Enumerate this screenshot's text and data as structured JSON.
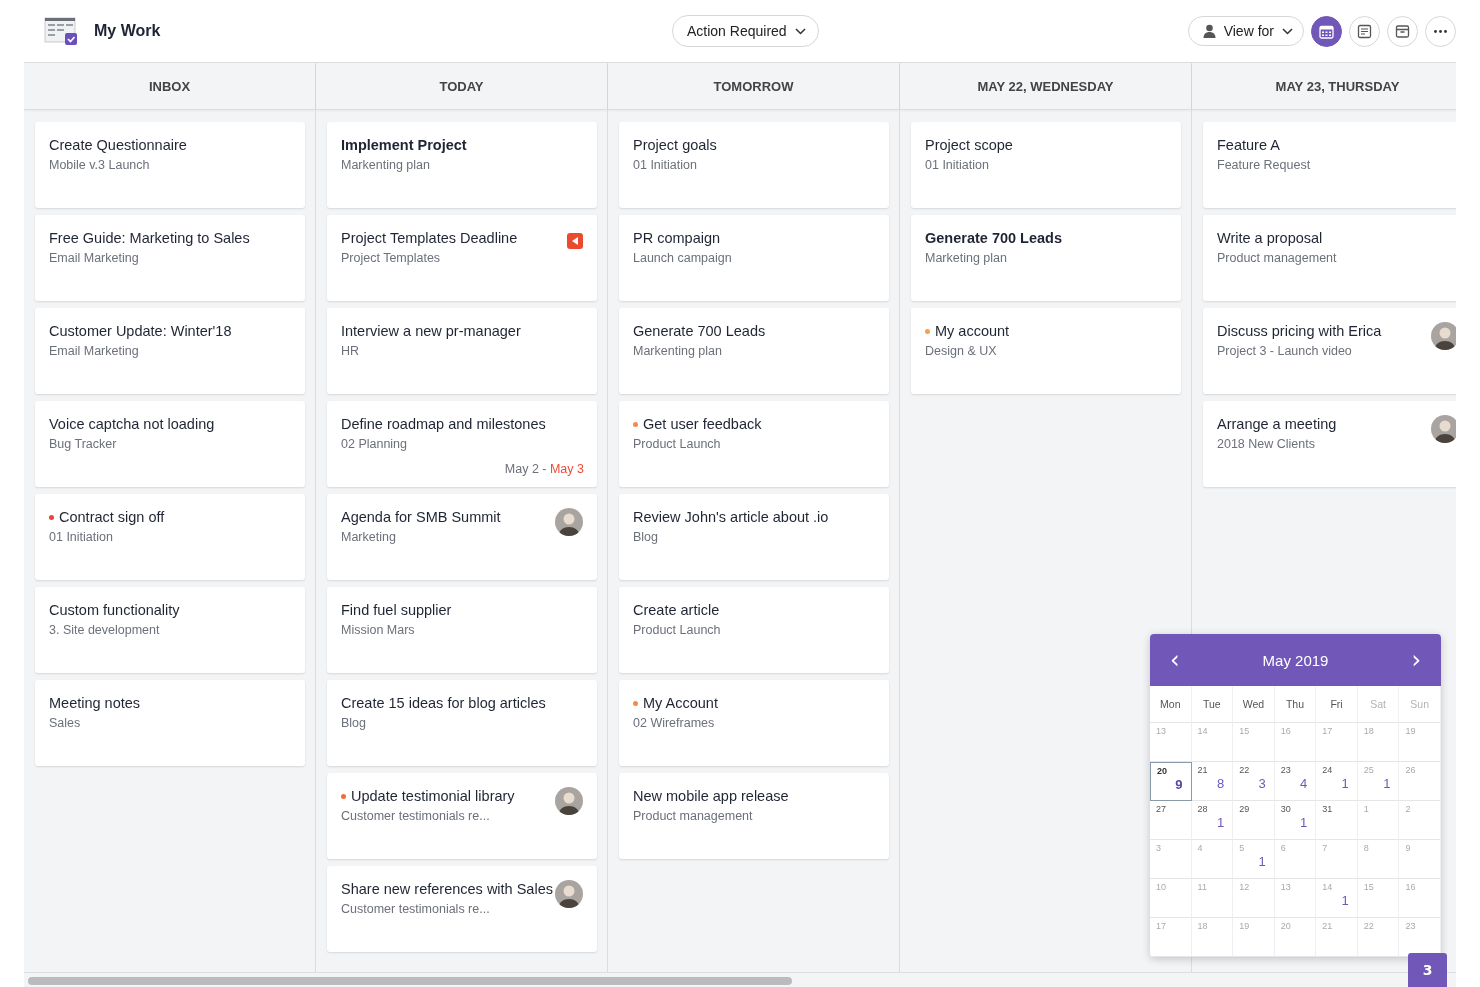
{
  "header": {
    "title": "My Work",
    "filter": "Action Required",
    "view_for": "View for",
    "view_buttons": [
      {
        "kind": "calendar",
        "selected": true
      },
      {
        "kind": "notes",
        "selected": false
      },
      {
        "kind": "archive",
        "selected": false
      },
      {
        "kind": "more",
        "selected": false
      }
    ]
  },
  "columns": [
    {
      "title": "INBOX",
      "cards": [
        {
          "title": "Create Questionnaire",
          "subtitle": "Mobile v.3 Launch"
        },
        {
          "title": "Free Guide: Marketing to Sales",
          "subtitle": "Email Marketing"
        },
        {
          "title": "Customer Update: Winter'18",
          "subtitle": "Email Marketing"
        },
        {
          "title": "Voice captcha not loading",
          "subtitle": "Bug Tracker"
        },
        {
          "title": "Contract sign off",
          "subtitle": "01 Initiation",
          "color": "#e8453c"
        },
        {
          "title": "Custom functionality",
          "subtitle": "3. Site development"
        },
        {
          "title": "Meeting notes",
          "subtitle": "Sales"
        }
      ]
    },
    {
      "title": "TODAY",
      "cards": [
        {
          "title": "Implement Project",
          "subtitle": "Markenting plan",
          "bold": true
        },
        {
          "title": "Project Templates Deadline",
          "subtitle": "Project Templates",
          "flag": true
        },
        {
          "title": "Interview a new pr-manager",
          "subtitle": "HR"
        },
        {
          "title": "Define roadmap and milestones",
          "subtitle": "02 Planning",
          "date_start": "May 2 -",
          "date_end": "May 3"
        },
        {
          "title": "Agenda for SMB Summit",
          "subtitle": "Marketing",
          "avatar": true
        },
        {
          "title": "Find fuel supplier",
          "subtitle": "Mission Mars"
        },
        {
          "title": "Create 15 ideas for blog articles",
          "subtitle": "Blog"
        },
        {
          "title": "Update testimonial library",
          "subtitle": "Customer testimonials re...",
          "color": "#f26b3a",
          "avatar": true
        },
        {
          "title": "Share new references with Sales",
          "subtitle": "Customer testimonials re...",
          "avatar": true
        }
      ]
    },
    {
      "title": "TOMORROW",
      "cards": [
        {
          "title": "Project goals",
          "subtitle": "01 Initiation"
        },
        {
          "title": "PR compaign",
          "subtitle": "Launch campaign"
        },
        {
          "title": "Generate 700 Leads",
          "subtitle": "Markenting plan"
        },
        {
          "title": "Get user feedback",
          "subtitle": "Product Launch",
          "color": "#f5894a"
        },
        {
          "title": "Review John's article about .io",
          "subtitle": "Blog"
        },
        {
          "title": "Create article",
          "subtitle": "Product Launch"
        },
        {
          "title": "My Account",
          "subtitle": "02 Wireframes",
          "color": "#f5894a"
        },
        {
          "title": "New mobile app release",
          "subtitle": "Product management"
        }
      ]
    },
    {
      "title": "MAY 22, WEDNESDAY",
      "cards": [
        {
          "title": "Project scope",
          "subtitle": "01 Initiation"
        },
        {
          "title": "Generate 700 Leads",
          "subtitle": "Marketing plan",
          "bold": true
        },
        {
          "title": "My account",
          "subtitle": "Design & UX",
          "color": "#f5a04a"
        }
      ]
    },
    {
      "title": "MAY 23, THURSDAY",
      "cards": [
        {
          "title": "Feature A",
          "subtitle": "Feature Request"
        },
        {
          "title": "Write a proposal",
          "subtitle": "Product management"
        },
        {
          "title": "Discuss pricing with Erica",
          "subtitle": "Project 3 - Launch video",
          "avatar": true
        },
        {
          "title": "Arrange a meeting",
          "subtitle": "2018 New Clients",
          "avatar": true
        }
      ]
    }
  ],
  "calendar": {
    "month": "May 2019",
    "prev": "‹",
    "next": "›",
    "weekdays": [
      {
        "label": "Mon",
        "muted": false
      },
      {
        "label": "Tue",
        "muted": false
      },
      {
        "label": "Wed",
        "muted": false
      },
      {
        "label": "Thu",
        "muted": false
      },
      {
        "label": "Fri",
        "muted": false
      },
      {
        "label": "Sat",
        "muted": true
      },
      {
        "label": "Sun",
        "muted": true
      }
    ],
    "weeks": [
      [
        {
          "day": "13",
          "muted": true
        },
        {
          "day": "14",
          "muted": true
        },
        {
          "day": "15",
          "muted": true
        },
        {
          "day": "16",
          "muted": true
        },
        {
          "day": "17",
          "muted": true
        },
        {
          "day": "18",
          "muted": true
        },
        {
          "day": "19",
          "muted": true
        }
      ],
      [
        {
          "day": "20",
          "muted": false,
          "selected": true,
          "count": "9"
        },
        {
          "day": "21",
          "muted": false,
          "count": "8"
        },
        {
          "day": "22",
          "muted": false,
          "count": "3"
        },
        {
          "day": "23",
          "muted": false,
          "count": "4"
        },
        {
          "day": "24",
          "muted": false,
          "count": "1"
        },
        {
          "day": "25",
          "muted": true,
          "count": "1"
        },
        {
          "day": "26",
          "muted": true
        }
      ],
      [
        {
          "day": "27",
          "muted": false
        },
        {
          "day": "28",
          "muted": false,
          "count": "1"
        },
        {
          "day": "29",
          "muted": false
        },
        {
          "day": "30",
          "muted": false,
          "count": "1"
        },
        {
          "day": "31",
          "muted": false
        },
        {
          "day": "1",
          "muted": true
        },
        {
          "day": "2",
          "muted": true
        }
      ],
      [
        {
          "day": "3",
          "muted": true
        },
        {
          "day": "4",
          "muted": true
        },
        {
          "day": "5",
          "muted": true,
          "count": "1"
        },
        {
          "day": "6",
          "muted": true
        },
        {
          "day": "7",
          "muted": true
        },
        {
          "day": "8",
          "muted": true
        },
        {
          "day": "9",
          "muted": true
        }
      ],
      [
        {
          "day": "10",
          "muted": true
        },
        {
          "day": "11",
          "muted": true
        },
        {
          "day": "12",
          "muted": true
        },
        {
          "day": "13",
          "muted": true
        },
        {
          "day": "14",
          "muted": true,
          "count": "1"
        },
        {
          "day": "15",
          "muted": true
        },
        {
          "day": "16",
          "muted": true
        }
      ],
      [
        {
          "day": "17",
          "muted": true
        },
        {
          "day": "18",
          "muted": true
        },
        {
          "day": "19",
          "muted": true
        },
        {
          "day": "20",
          "muted": true
        },
        {
          "day": "21",
          "muted": true
        },
        {
          "day": "22",
          "muted": true
        },
        {
          "day": "23",
          "muted": true
        }
      ]
    ]
  },
  "badge": "3"
}
